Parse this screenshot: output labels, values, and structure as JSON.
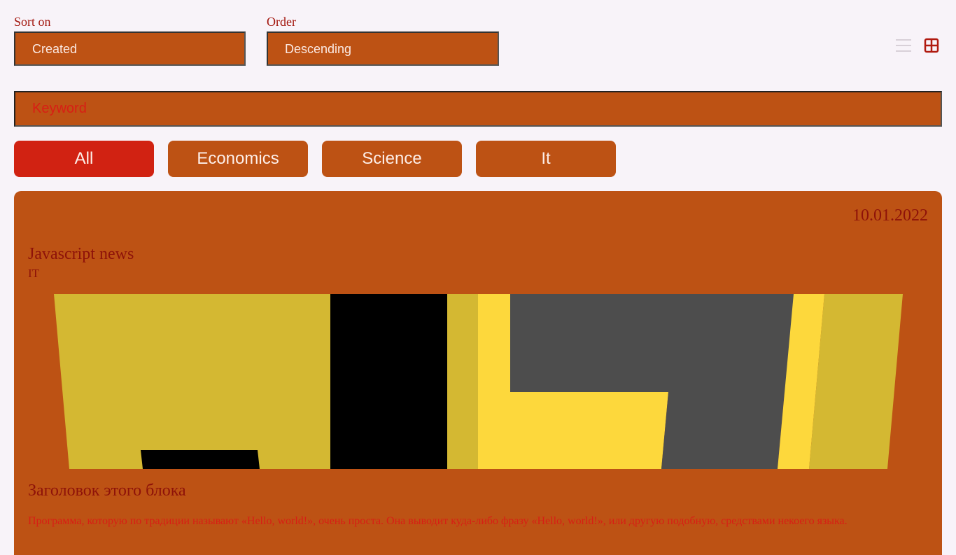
{
  "sort": {
    "label": "Sort on",
    "value": "Created"
  },
  "order": {
    "label": "Order",
    "value": "Descending"
  },
  "view": {
    "list_icon": "list-icon",
    "grid_icon": "grid-icon",
    "active": "grid"
  },
  "search": {
    "placeholder": "Keyword"
  },
  "filters": [
    {
      "label": "All",
      "active": true
    },
    {
      "label": "Economics",
      "active": false
    },
    {
      "label": "Science",
      "active": false
    },
    {
      "label": "It",
      "active": false
    }
  ],
  "card": {
    "date": "10.01.2022",
    "title": "Javascript news",
    "category": "IT",
    "block_title": "Заголовок этого блока",
    "block_text": "Программа, которую по традиции называют «Hello, world!», очень проста. Она выводит куда-либо фразу «Hello, world!», или другую подобную, средствами некоего языка."
  },
  "colors": {
    "background": "#f8f3f9",
    "accent": "#bd5214",
    "active_filter": "#d12212",
    "text_dark_red": "#8e1209",
    "text_red": "#d81e14"
  }
}
